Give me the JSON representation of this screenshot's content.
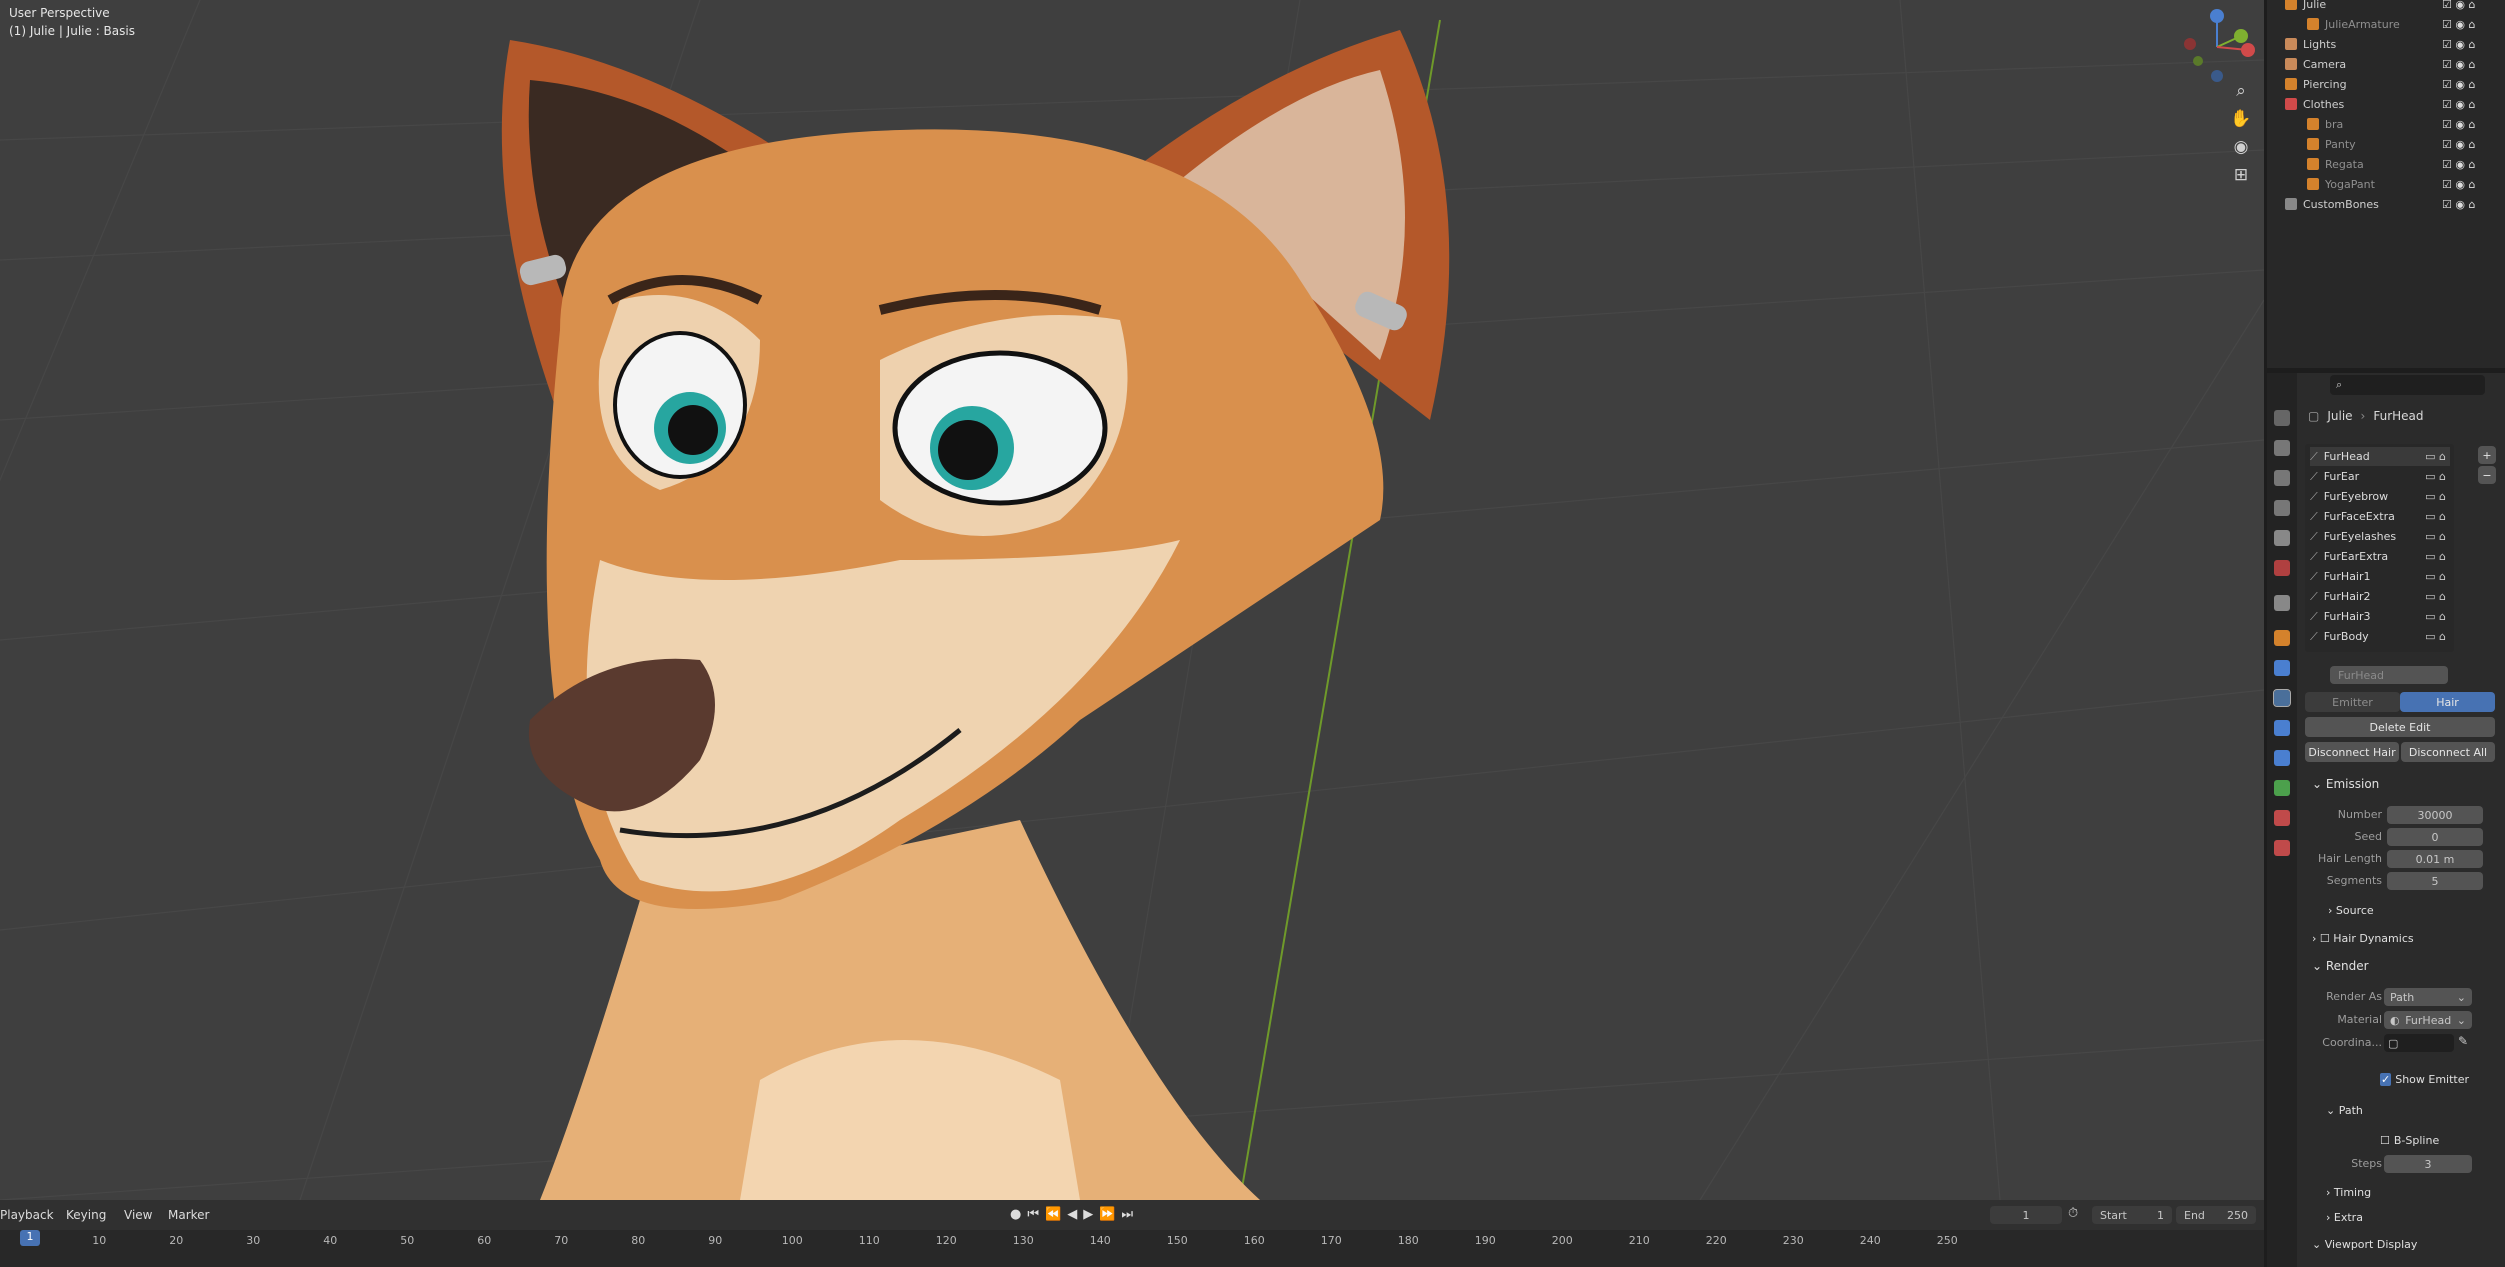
{
  "viewport": {
    "mode": "User Perspective",
    "object": "(1) Julie | Julie : Basis"
  },
  "outliner": [
    {
      "label": "Julie",
      "indent": 1
    },
    {
      "label": "JulieArmature",
      "indent": 2
    },
    {
      "label": "Lights",
      "indent": 1
    },
    {
      "label": "Camera",
      "indent": 1
    },
    {
      "label": "Piercing",
      "indent": 1
    },
    {
      "label": "Clothes",
      "indent": 1
    },
    {
      "label": "bra",
      "indent": 2
    },
    {
      "label": "Panty",
      "indent": 2
    },
    {
      "label": "Regata",
      "indent": 2
    },
    {
      "label": "YogaPant",
      "indent": 2
    },
    {
      "label": "CustomBones",
      "indent": 1
    }
  ],
  "properties": {
    "breadcrumb": {
      "object": "Julie",
      "system": "FurHead"
    },
    "particle_systems": [
      "FurHead",
      "FurEar",
      "FurEyebrow",
      "FurFaceExtra",
      "FurEyelashes",
      "FurEarExtra",
      "FurHair1",
      "FurHair2",
      "FurHair3",
      "FurBody"
    ],
    "active_system": "FurHead",
    "type_tabs": {
      "emitter": "Emitter",
      "hair": "Hair"
    },
    "buttons": {
      "delete_edit": "Delete Edit",
      "disconnect_hair": "Disconnect Hair",
      "disconnect_all": "Disconnect All"
    },
    "emission": {
      "title": "Emission",
      "number_label": "Number",
      "number": "30000",
      "seed_label": "Seed",
      "seed": "0",
      "hair_length_label": "Hair Length",
      "hair_length": "0.01 m",
      "segments_label": "Segments",
      "segments": "5",
      "source": "Source"
    },
    "hair_dynamics": "Hair Dynamics",
    "render": {
      "title": "Render",
      "render_as_label": "Render As",
      "render_as": "Path",
      "material_label": "Material",
      "material": "FurHead",
      "coordinate_label": "Coordina...",
      "show_emitter": "Show Emitter",
      "path": "Path",
      "bspline": "B-Spline",
      "steps_label": "Steps",
      "steps": "3",
      "timing": "Timing",
      "extra": "Extra"
    },
    "viewport_display": "Viewport Display"
  },
  "timeline": {
    "menus": [
      "Playback",
      "Keying",
      "View",
      "Marker"
    ],
    "current_frame": "1",
    "start_label": "Start",
    "start": "1",
    "end_label": "End",
    "end": "250",
    "ticks": [
      "1",
      "10",
      "20",
      "30",
      "40",
      "50",
      "60",
      "70",
      "80",
      "90",
      "100",
      "110",
      "120",
      "130",
      "140",
      "150",
      "160",
      "170",
      "180",
      "190",
      "200",
      "210",
      "220",
      "230",
      "240",
      "250"
    ]
  }
}
